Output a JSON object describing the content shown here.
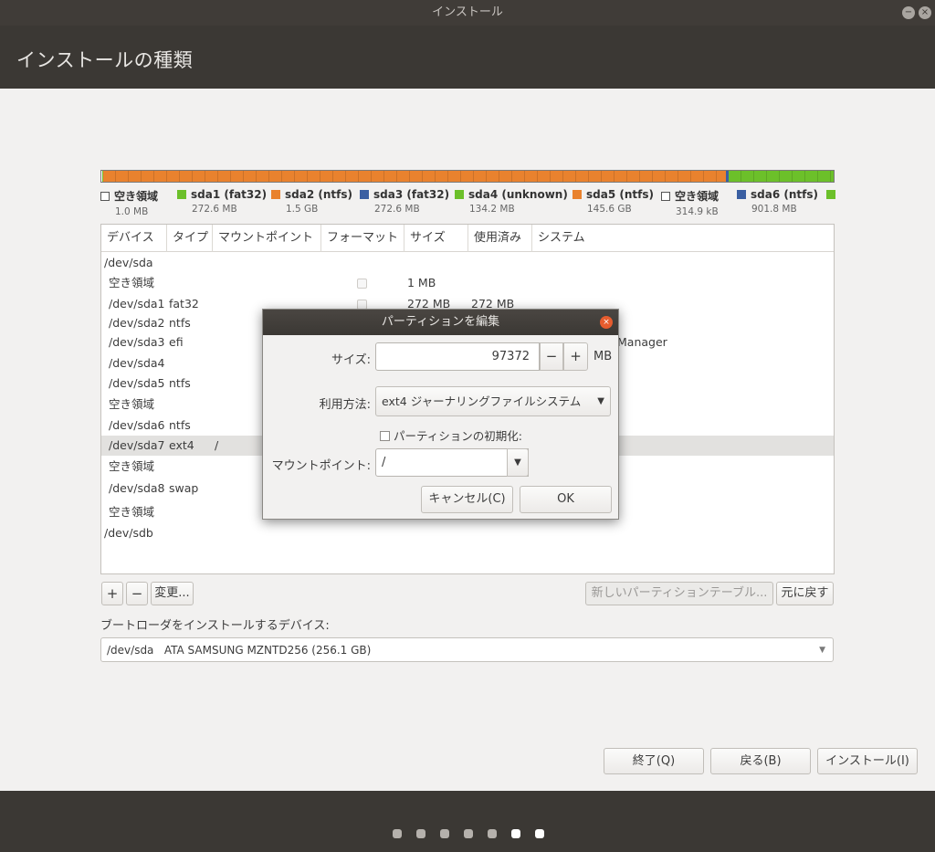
{
  "window": {
    "title": "インストール",
    "min_icon": "−",
    "close_icon": "×"
  },
  "header": {
    "title": "インストールの種類"
  },
  "colors": {
    "orange": "#e9822e",
    "green": "#6cc02a",
    "blue": "#3b5fa2",
    "free": "#ffffff",
    "dialog_close": "#e65c2e"
  },
  "partition_bar": {
    "segments": [
      {
        "name": "free",
        "color": "#ffffff",
        "fraction": 0.001
      },
      {
        "name": "sda1",
        "color": "#6cc02a",
        "fraction": 0.001
      },
      {
        "name": "sda2",
        "color": "#e9822e",
        "fraction": 0.851
      },
      {
        "name": "sda3",
        "color": "#3b5fa2",
        "fraction": 0.004
      },
      {
        "name": "sda4",
        "color": "#6cc02a",
        "fraction": 0.143
      }
    ]
  },
  "legend": [
    {
      "name": "空き領域",
      "size": "1.0 MB",
      "color": "free"
    },
    {
      "name": "sda1 (fat32)",
      "size": "272.6 MB",
      "color": "#6cc02a"
    },
    {
      "name": "sda2 (ntfs)",
      "size": "1.5 GB",
      "color": "#e9822e"
    },
    {
      "name": "sda3 (fat32)",
      "size": "272.6 MB",
      "color": "#3b5fa2"
    },
    {
      "name": "sda4 (unknown)",
      "size": "134.2 MB",
      "color": "#6cc02a"
    },
    {
      "name": "sda5 (ntfs)",
      "size": "145.6 GB",
      "color": "#e9822e"
    },
    {
      "name": "空き領域",
      "size": "314.9 kB",
      "color": "free"
    },
    {
      "name": "sda6 (ntfs)",
      "size": "901.8 MB",
      "color": "#3b5fa2"
    },
    {
      "name": "",
      "size": "",
      "color": "#6cc02a"
    }
  ],
  "table": {
    "headers": [
      "デバイス",
      "タイプ",
      "マウントポイント",
      "フォーマット",
      "サイズ",
      "使用済み",
      "システム"
    ],
    "rows": [
      {
        "device": "/dev/sda",
        "type": "",
        "mount": "",
        "format": false,
        "size": "",
        "used": "",
        "system": "",
        "indent": false
      },
      {
        "device": "空き領域",
        "type": "",
        "mount": "",
        "format": true,
        "size": "1 MB",
        "used": "",
        "system": "",
        "indent": true
      },
      {
        "device": "/dev/sda1",
        "type": "fat32",
        "mount": "",
        "format": true,
        "size": "272 MB",
        "used": "272 MB",
        "system": "",
        "indent": true
      },
      {
        "device": "/dev/sda2",
        "type": "ntfs",
        "mount": "",
        "format": false,
        "size": "",
        "used": "",
        "system": "",
        "indent": true
      },
      {
        "device": "/dev/sda3",
        "type": "efi",
        "mount": "",
        "format": false,
        "size": "",
        "used": "",
        "system": "Manager",
        "indent": true
      },
      {
        "device": "/dev/sda4",
        "type": "",
        "mount": "",
        "format": false,
        "size": "",
        "used": "",
        "system": "",
        "indent": true
      },
      {
        "device": "/dev/sda5",
        "type": "ntfs",
        "mount": "",
        "format": false,
        "size": "",
        "used": "",
        "system": "",
        "indent": true
      },
      {
        "device": "空き領域",
        "type": "",
        "mount": "",
        "format": false,
        "size": "",
        "used": "",
        "system": "",
        "indent": true
      },
      {
        "device": "/dev/sda6",
        "type": "ntfs",
        "mount": "",
        "format": false,
        "size": "",
        "used": "",
        "system": "",
        "indent": true
      },
      {
        "device": "/dev/sda7",
        "type": "ext4",
        "mount": "/",
        "format": false,
        "size": "",
        "used": "",
        "system": "",
        "indent": true,
        "selected": true
      },
      {
        "device": "空き領域",
        "type": "",
        "mount": "",
        "format": false,
        "size": "",
        "used": "",
        "system": "",
        "indent": true
      },
      {
        "device": "/dev/sda8",
        "type": "swap",
        "mount": "",
        "format": false,
        "size": "",
        "used": "",
        "system": "",
        "indent": true
      },
      {
        "device": "空き領域",
        "type": "",
        "mount": "",
        "format": false,
        "size": "",
        "used": "",
        "system": "",
        "indent": true
      },
      {
        "device": "/dev/sdb",
        "type": "",
        "mount": "",
        "format": false,
        "size": "",
        "used": "",
        "system": "",
        "indent": false
      }
    ]
  },
  "table_buttons": {
    "add": "+",
    "remove": "−",
    "change": "変更...",
    "new_table": "新しいパーティションテーブル...",
    "revert": "元に戻す"
  },
  "bootloader": {
    "label": "ブートローダをインストールするデバイス:",
    "value": "/dev/sda   ATA SAMSUNG MZNTD256 (256.1 GB)"
  },
  "nav_buttons": {
    "quit": "終了(Q)",
    "back": "戻る(B)",
    "install": "インストール(I)"
  },
  "progress_dots": {
    "total": 7,
    "active": [
      5,
      6
    ]
  },
  "dialog": {
    "title": "パーティションを編集",
    "close_icon": "×",
    "size_label": "サイズ:",
    "size_value": "97372",
    "size_unit": "MB",
    "minus": "−",
    "plus": "+",
    "use_label": "利用方法:",
    "use_value": "ext4 ジャーナリングファイルシステム",
    "format_label": "パーティションの初期化:",
    "format_checked": false,
    "mount_label": "マウントポイント:",
    "mount_value": "/",
    "cancel": "キャンセル(C)",
    "ok": "OK"
  }
}
